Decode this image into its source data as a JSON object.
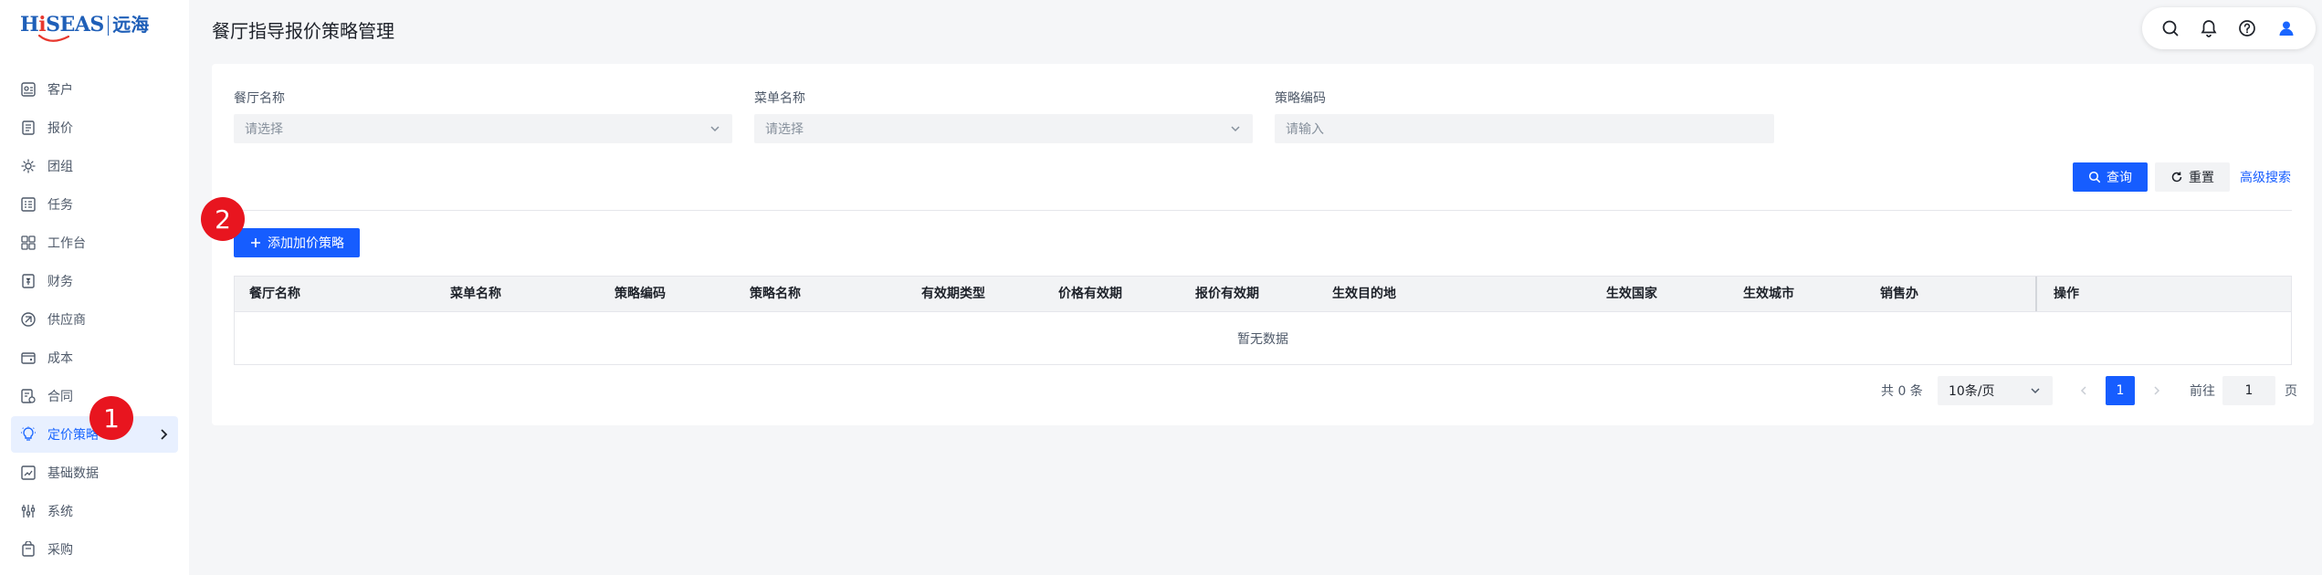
{
  "logo": {
    "brand_h": "H",
    "brand_i": "i",
    "brand_rest": "SEAS",
    "brand_cn": "远海"
  },
  "page": {
    "title": "餐厅指导报价策略管理"
  },
  "sidebar": {
    "items": [
      {
        "label": "客户",
        "icon": "customer-icon"
      },
      {
        "label": "报价",
        "icon": "quote-icon"
      },
      {
        "label": "团组",
        "icon": "group-icon"
      },
      {
        "label": "任务",
        "icon": "task-icon"
      },
      {
        "label": "工作台",
        "icon": "workbench-icon"
      },
      {
        "label": "财务",
        "icon": "finance-icon"
      },
      {
        "label": "供应商",
        "icon": "supplier-icon"
      },
      {
        "label": "成本",
        "icon": "cost-icon"
      },
      {
        "label": "合同",
        "icon": "contract-icon"
      },
      {
        "label": "定价策略",
        "icon": "pricing-icon",
        "active": true
      },
      {
        "label": "基础数据",
        "icon": "basedata-icon"
      },
      {
        "label": "系统",
        "icon": "system-icon"
      },
      {
        "label": "采购",
        "icon": "purchase-icon"
      }
    ]
  },
  "filters": {
    "restaurant": {
      "label": "餐厅名称",
      "placeholder": "请选择"
    },
    "menu": {
      "label": "菜单名称",
      "placeholder": "请选择"
    },
    "code": {
      "label": "策略编码",
      "placeholder": "请输入"
    }
  },
  "actions": {
    "search": "查询",
    "reset": "重置",
    "advanced": "高级搜索",
    "add": "添加加价策略"
  },
  "table": {
    "columns": [
      "餐厅名称",
      "菜单名称",
      "策略编码",
      "策略名称",
      "有效期类型",
      "价格有效期",
      "报价有效期",
      "生效目的地",
      "生效国家",
      "生效城市",
      "销售办",
      "操作"
    ],
    "empty_text": "暂无数据"
  },
  "pagination": {
    "total": "共 0 条",
    "page_size": "10条/页",
    "current_page": "1",
    "goto_label": "前往",
    "goto_value": "1",
    "page_unit": "页"
  },
  "badges": {
    "one": "1",
    "two": "2"
  },
  "colors": {
    "primary": "#165dff",
    "badge": "#e8151f",
    "active_nav_bg": "#e8f0ff"
  }
}
